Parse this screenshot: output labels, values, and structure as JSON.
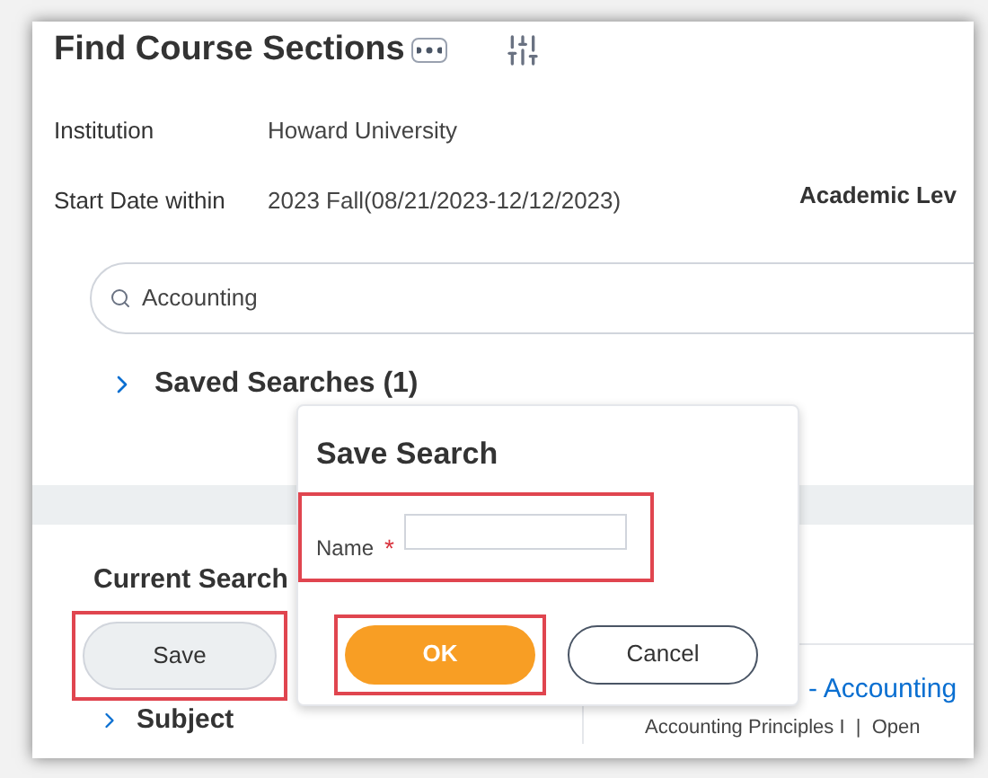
{
  "page": {
    "title": "Find Course Sections"
  },
  "filters": [
    {
      "label": "Institution",
      "value": "Howard University"
    },
    {
      "label": "Start Date within",
      "value": "2023 Fall(08/21/2023-12/12/2023)"
    }
  ],
  "academic_level_label": "Academic Lev",
  "search": {
    "value": "Accounting"
  },
  "saved_searches": {
    "label": "Saved Searches (1)",
    "expanded": false
  },
  "current_search": {
    "heading": "Current Search",
    "save_button": {
      "label": "Save",
      "highlighted": true
    }
  },
  "facets": [
    {
      "label": "Subject",
      "expanded": false
    }
  ],
  "result": {
    "title": "- Accounting",
    "subtitle": "Accounting Principles I  |  Open"
  },
  "dialog": {
    "title": "Save Search",
    "field": {
      "label": "Name",
      "required_mark": "*",
      "highlighted": true
    },
    "buttons": [
      {
        "label": "OK",
        "kind": "primary",
        "highlighted": true
      },
      {
        "label": "Cancel",
        "kind": "secondary",
        "highlighted": false
      }
    ]
  }
}
